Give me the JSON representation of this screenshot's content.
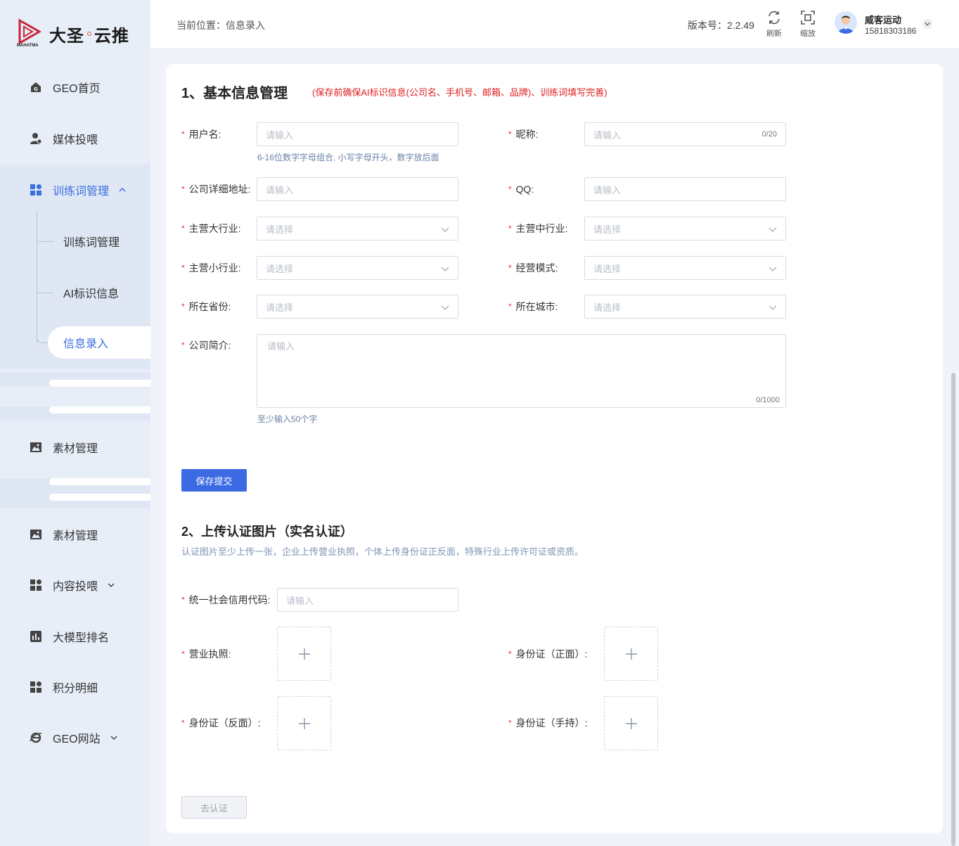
{
  "logo": {
    "brand": "MAHATMA",
    "name_a": "大圣",
    "name_b": "云推"
  },
  "sidebar": {
    "items": [
      {
        "label": "GEO首页"
      },
      {
        "label": "媒体投喂"
      },
      {
        "label": "训练词管理"
      },
      {
        "label": "素材管理"
      },
      {
        "label": "素材管理"
      },
      {
        "label": "内容投喂"
      },
      {
        "label": "大模型排名"
      },
      {
        "label": "积分明细"
      },
      {
        "label": "GEO网站"
      }
    ],
    "sub_items": [
      {
        "label": "训练词管理"
      },
      {
        "label": "AI标识信息"
      },
      {
        "label": "信息录入"
      }
    ]
  },
  "header": {
    "breadcrumb": "当前位置：信息录入",
    "version": "版本号：2.2.49",
    "refresh_label": "刷新",
    "zoom_label": "缩放",
    "user_name": "威客运动",
    "user_phone": "15818303186"
  },
  "section1": {
    "title": "1、基本信息管理",
    "note": "(保存前确保AI标识信息(公司名、手机号、邮箱、品牌)、训练词填写完善)",
    "fields": {
      "username": {
        "label": "用户名:",
        "placeholder": "请输入",
        "hint": "6-16位数字字母组合, 小写字母开头，数字放后面"
      },
      "nickname": {
        "label": "昵称:",
        "placeholder": "请输入",
        "counter": "0/20"
      },
      "address": {
        "label": "公司详细地址:",
        "placeholder": "请输入"
      },
      "qq": {
        "label": "QQ:",
        "placeholder": "请输入"
      },
      "industry_major": {
        "label": "主营大行业:",
        "placeholder": "请选择"
      },
      "industry_mid": {
        "label": "主营中行业:",
        "placeholder": "请选择"
      },
      "industry_minor": {
        "label": "主营小行业:",
        "placeholder": "请选择"
      },
      "business_mode": {
        "label": "经营模式:",
        "placeholder": "请选择"
      },
      "province": {
        "label": "所在省份:",
        "placeholder": "请选择"
      },
      "city": {
        "label": "所在城市:",
        "placeholder": "请选择"
      },
      "intro": {
        "label": "公司简介:",
        "placeholder": "请输入",
        "counter": "0/1000",
        "hint": "至少输入50个字"
      }
    },
    "submit_label": "保存提交"
  },
  "section2": {
    "title": "2、上传认证图片（实名认证）",
    "note": "认证图片至少上传一张，企业上传营业执照，个体上传身份证正反面，特殊行业上传许可证或资质。",
    "credit_code": {
      "label": "统一社会信用代码:",
      "placeholder": "请输入"
    },
    "license_label": "营业执照:",
    "id_front_label": "身份证（正面）:",
    "id_back_label": "身份证（反面）:",
    "id_hold_label": "身份证（手持）:",
    "verify_label": "去认证"
  },
  "colors": {
    "accent": "#3b6ae3",
    "required": "#e33333",
    "sidebar_bg": "#e8eef8"
  }
}
